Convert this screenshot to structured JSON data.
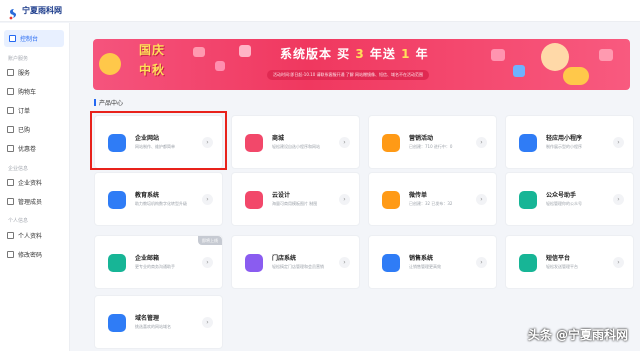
{
  "app": {
    "brand": "宁夏雨科网"
  },
  "sidebar": {
    "active": {
      "label": "控制台"
    },
    "groups": [
      {
        "title": "账户服务",
        "items": [
          {
            "label": "服务"
          },
          {
            "label": "购物车"
          },
          {
            "label": "订单"
          },
          {
            "label": "已购"
          },
          {
            "label": "优惠卷"
          }
        ]
      },
      {
        "title": "企业信息",
        "items": [
          {
            "label": "企业资料"
          },
          {
            "label": "管理成员"
          }
        ]
      },
      {
        "title": "个人信息",
        "items": [
          {
            "label": "个人资料"
          },
          {
            "label": "修改密码"
          }
        ]
      }
    ]
  },
  "banner": {
    "title_line1": "国庆",
    "title_line2": "中秋",
    "headline_a": "系统版本 买",
    "headline_b": "3",
    "headline_c": "年送",
    "headline_d": "1",
    "headline_e": "年",
    "sub": "活动时间:即日起-10.10    请联系客服开通 了解  网站赠镜像、短信、域名不在活动范围"
  },
  "section": {
    "title": "产品中心"
  },
  "products": [
    {
      "name": "企业网站",
      "desc": "网站制作、维护都简单",
      "color": "#2f7cf6"
    },
    {
      "name": "商城",
      "desc": "轻松建设自选小程序和网站",
      "color": "#f2486a"
    },
    {
      "name": "营销活动",
      "desc": "已创建：710   进行中：0",
      "color": "#ff9a16"
    },
    {
      "name": "轻应用小程序",
      "desc": "制作展示型的小程序",
      "color": "#2f7cf6"
    },
    {
      "name": "教育系统",
      "desc": "助力教培机构数字化转型升级",
      "color": "#2f7cf6"
    },
    {
      "name": "云设计",
      "desc": "海量可商用模板图片 制图",
      "color": "#f2486a"
    },
    {
      "name": "微传单",
      "desc": "已创建：32   已发布：32",
      "color": "#ff9a16"
    },
    {
      "name": "公众号助手",
      "desc": "轻松管理你的公众号",
      "color": "#17b596"
    },
    {
      "name": "企业邮箱",
      "desc": "更专业的商务沟通助手",
      "color": "#17b596",
      "tag": "即将上线"
    },
    {
      "name": "门店系统",
      "desc": "轻松搞定门店管理和会员营销",
      "color": "#8a5cf0"
    },
    {
      "name": "销售系统",
      "desc": "让销售管理更高效",
      "color": "#2f7cf6"
    },
    {
      "name": "短信平台",
      "desc": "轻松发送管理平台",
      "color": "#17b596"
    },
    {
      "name": "域名管理",
      "desc": "挑选喜欢的网站域名",
      "color": "#2f7cf6"
    }
  ],
  "watermark": "头条 @宁夏雨科网",
  "colors": {
    "accent": "#2468f2",
    "highlight": "#e8221b",
    "banner": "#f0385f"
  }
}
